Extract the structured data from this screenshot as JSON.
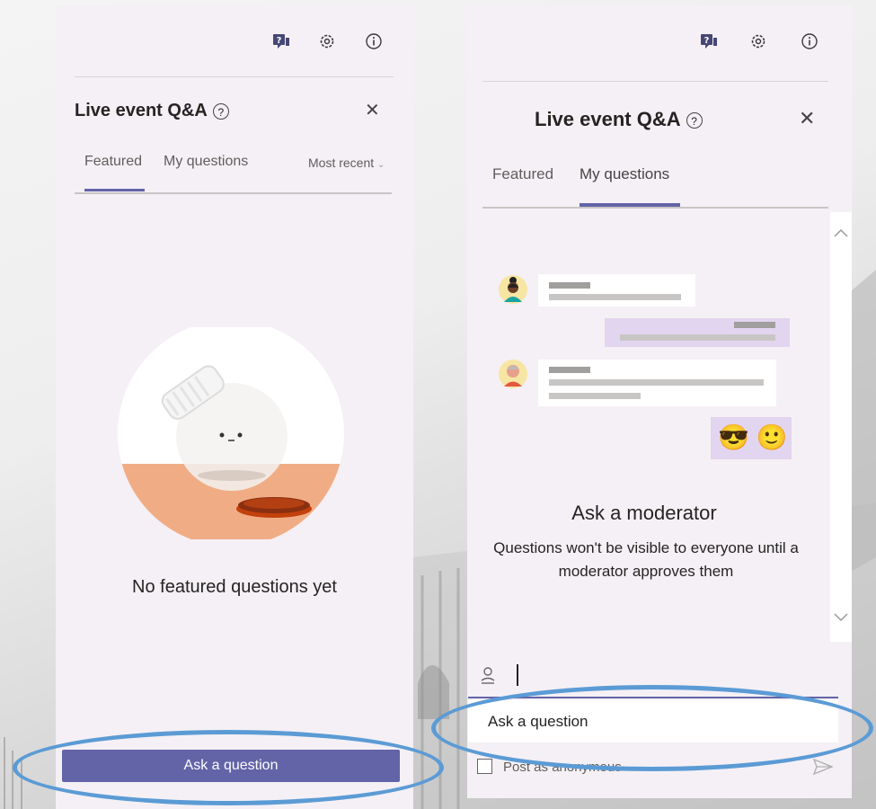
{
  "left_panel": {
    "title": "Live event Q&A",
    "help_glyph": "?",
    "close_glyph": "✕",
    "tabs": [
      {
        "label": "Featured",
        "active": true
      },
      {
        "label": "My questions",
        "active": false
      }
    ],
    "sort_label": "Most recent",
    "sort_chevron": "⌄",
    "empty_text": "No featured questions yet",
    "ask_button": "Ask a question"
  },
  "right_panel": {
    "title": "Live event Q&A",
    "help_glyph": "?",
    "close_glyph": "✕",
    "tabs": [
      {
        "label": "Featured",
        "active": false
      },
      {
        "label": "My questions",
        "active": true
      }
    ],
    "emojis": "😎 🙂",
    "heading": "Ask a moderator",
    "description": "Questions won't be visible to everyone until a moderator approves them",
    "input_placeholder": "Ask a question",
    "anonymous_label": "Post as anonymous"
  },
  "icons": [
    "qa-icon",
    "settings-icon",
    "info-icon",
    "close-icon",
    "scroll-up-icon",
    "scroll-down-icon",
    "person-icon",
    "send-icon"
  ],
  "colors": {
    "accent": "#6264a7",
    "panel_bg": "#f5f0f5",
    "highlight_oval": "#5b9bd5",
    "own_message": "#e2d5ef"
  }
}
